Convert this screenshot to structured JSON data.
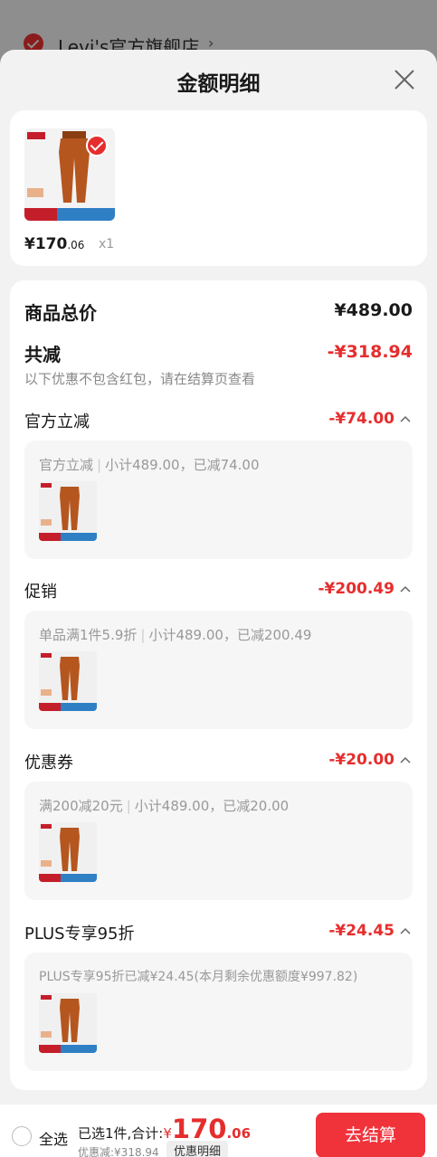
{
  "background": {
    "store_name": "Levi's官方旗舰店",
    "store_arrow": "›"
  },
  "sheet": {
    "title": "金额明细"
  },
  "product": {
    "price_main": "¥170",
    "price_dec": ".06",
    "qty": "x1"
  },
  "summary": {
    "total_label": "商品总价",
    "total_value": "¥489.00",
    "reduce_label": "共减",
    "reduce_value": "-¥318.94",
    "note": "以下优惠不包含红包，请在结算页查看"
  },
  "sections": [
    {
      "label": "官方立减",
      "value": "-¥74.00",
      "desc_a": "官方立减",
      "desc_b": "小计489.00，已减74.00"
    },
    {
      "label": "促销",
      "value": "-¥200.49",
      "desc_a": "单品满1件5.9折",
      "desc_b": "小计489.00，已减200.49"
    },
    {
      "label": "优惠券",
      "value": "-¥20.00",
      "desc_a": "满200减20元",
      "desc_b": "小计489.00，已减20.00"
    },
    {
      "label": "PLUS专享95折",
      "value": "-¥24.45",
      "desc_a": "PLUS专享95折已减¥24.45(本月剩余优惠额度¥997.82)",
      "desc_b": ""
    }
  ],
  "bottom": {
    "select_all": "全选",
    "selected_label": "已选1件,合计:",
    "yen": "¥",
    "total_int": "170",
    "total_dec": ".06",
    "discount": "优惠减:¥318.94",
    "detail_link": "优惠明细",
    "checkout": "去结算"
  },
  "colors": {
    "accent": "#e62d2d",
    "button": "#f0323a",
    "pants": "#b5561f"
  },
  "icons": [
    "close-icon",
    "caret-up-icon",
    "check-icon",
    "radio-icon"
  ]
}
